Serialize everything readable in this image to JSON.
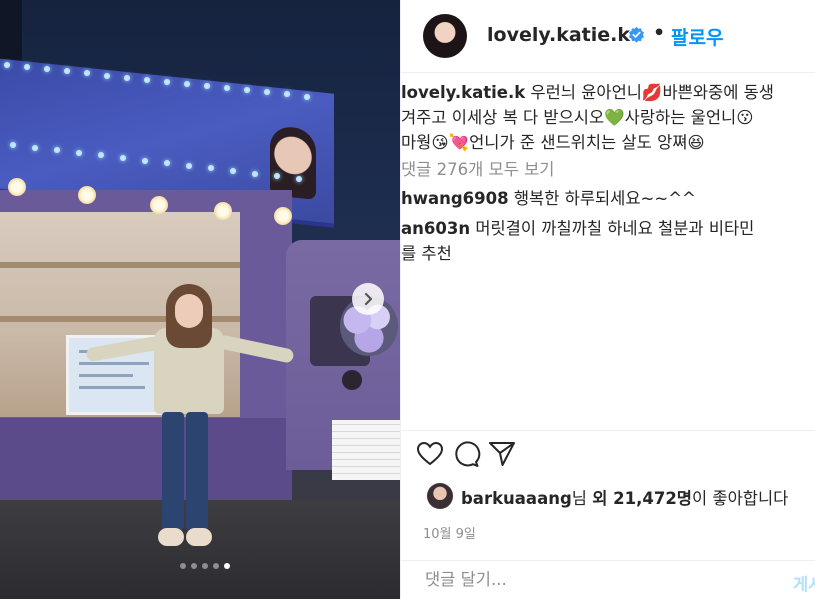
{
  "post": {
    "username": "lovely.katie.k",
    "separator": "•",
    "follow_label": "팔로우",
    "caption": {
      "username": "lovely.katie.k",
      "line1": " 우런늬 윤아언니💋바쁜와중에 동생",
      "line2": "겨주고 이세상 복 다 받으시오💚사랑하는 울언니😗",
      "line3": "마웡😘💘언니가 준 샌드위치는 살도 앙쪄😆"
    },
    "view_all_comments": "댓글 276개 모두 보기",
    "comments": [
      {
        "user": "hwang6908",
        "text": " 행복한 하루되세요~~^^",
        "text2": ""
      },
      {
        "user": "an603n",
        "text": " 머릿결이 까칠까칠 하네요 철분과 비타민",
        "text2": "를 추천"
      }
    ],
    "likes": {
      "liker": "barkuaaang",
      "suffix_1": "님 ",
      "bold_part": "외 21,472명",
      "suffix_2": "이 좋아합니다"
    },
    "date": "10월 9일",
    "comment_placeholder": "댓글 달기...",
    "post_label": "게시"
  },
  "carousel": {
    "total": 5,
    "active_index": 4
  },
  "icons": {
    "heart": "heart-icon",
    "comment": "comment-icon",
    "share": "share-icon",
    "next": "chevron-right-icon",
    "verified": "verified-badge-icon"
  },
  "colors": {
    "accent": "#0095f6",
    "verified": "#3897f0",
    "muted": "#8e8e8e",
    "post_disabled": "#b2dffc"
  }
}
